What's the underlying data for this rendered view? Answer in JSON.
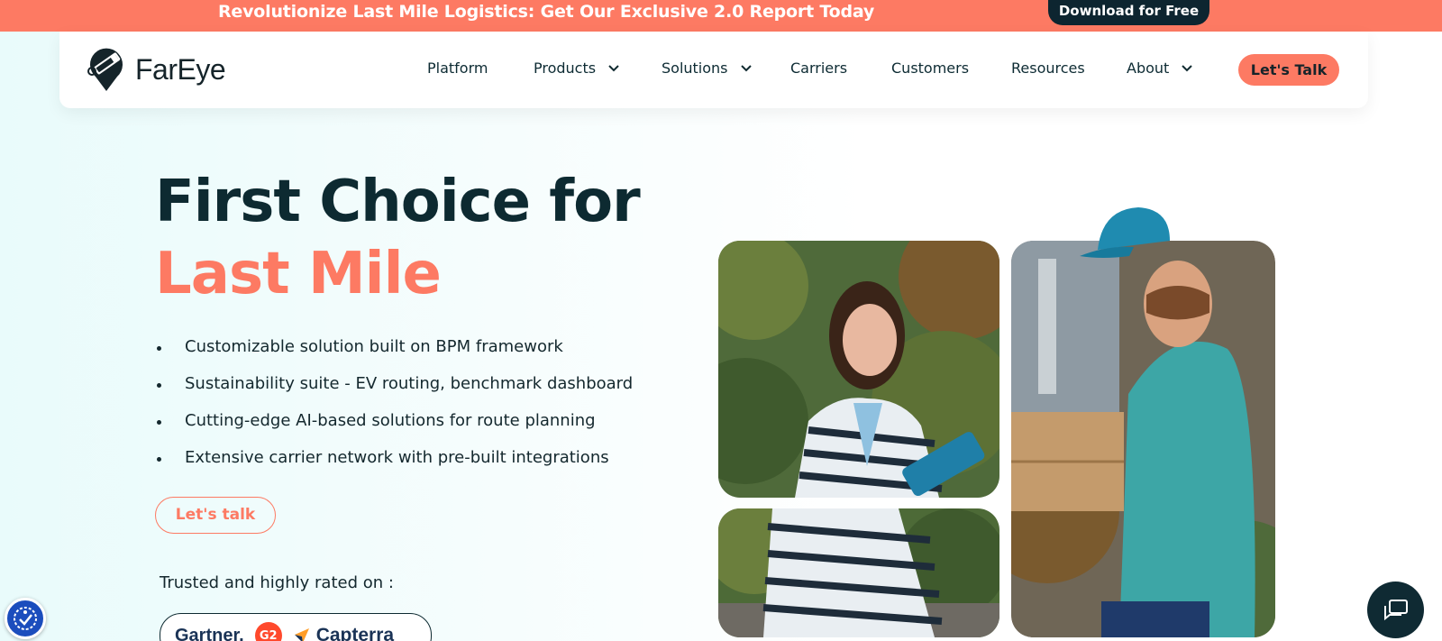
{
  "promo": {
    "text": "Revolutionize Last Mile Logistics: Get Our Exclusive 2.0 Report Today",
    "button": "Download for Free"
  },
  "nav": {
    "brand": "FarEye",
    "items": [
      {
        "label": "Platform",
        "has_dropdown": false
      },
      {
        "label": "Products",
        "has_dropdown": true
      },
      {
        "label": "Solutions",
        "has_dropdown": true
      },
      {
        "label": "Carriers",
        "has_dropdown": false
      },
      {
        "label": "Customers",
        "has_dropdown": false
      },
      {
        "label": "Resources",
        "has_dropdown": false
      },
      {
        "label": "About",
        "has_dropdown": true
      }
    ],
    "cta": "Let's Talk"
  },
  "hero": {
    "title_line1": "First Choice for",
    "title_line2": "Last Mile",
    "bullets": [
      "Customizable solution built on BPM framework",
      "Sustainability suite - EV routing, benchmark dashboard",
      "Cutting-edge AI-based solutions for route planning",
      "Extensive carrier network with pre-built integrations"
    ],
    "cta": "Let's talk",
    "trusted_label": "Trusted and highly rated on :",
    "ratings": {
      "gartner": "Gartner.",
      "g2": "G2",
      "capterra": "Capterra"
    }
  },
  "colors": {
    "accent": "#fd7a63",
    "dark": "#0d2a31",
    "promo_button": "#0d2530"
  },
  "icons": {
    "accessibility": "accessibility-icon",
    "chat": "chat-icon",
    "dropdown": "chevron-down-icon"
  }
}
